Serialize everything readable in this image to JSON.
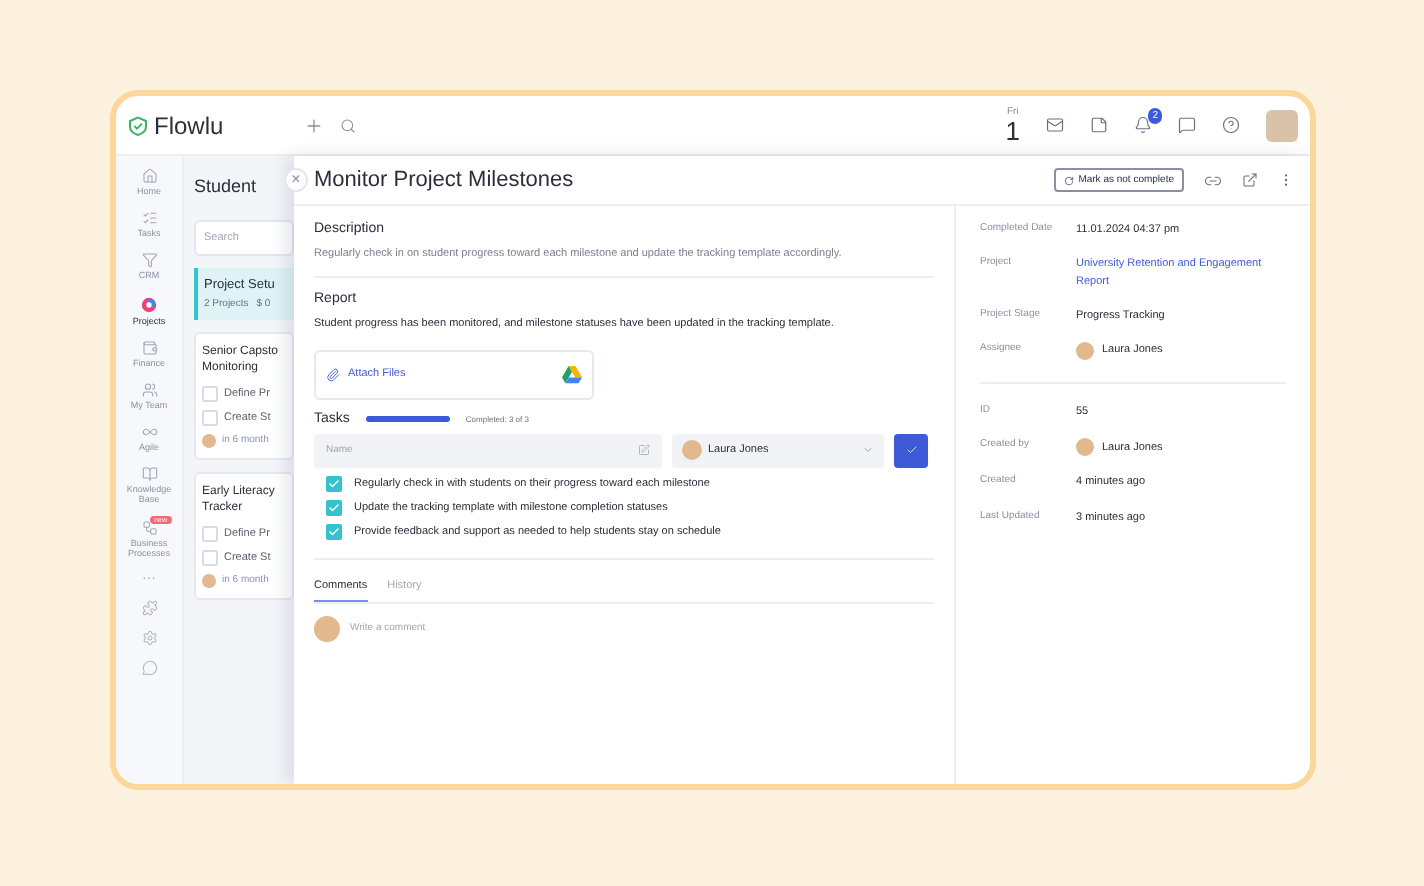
{
  "topbar": {
    "logo": "Flowlu",
    "day": "Fri",
    "date": "1",
    "notification_count": "2"
  },
  "sidebar": {
    "items": [
      {
        "label": "Home",
        "selected": false
      },
      {
        "label": "Tasks",
        "selected": false
      },
      {
        "label": "CRM",
        "selected": false
      },
      {
        "label": "Projects",
        "selected": true
      },
      {
        "label": "Finance",
        "selected": false
      },
      {
        "label": "My Team",
        "selected": false
      },
      {
        "label": "Agile",
        "selected": false
      },
      {
        "label": "Knowledge Base",
        "selected": false
      },
      {
        "label": "Business Processes",
        "selected": false,
        "badge": "new"
      }
    ],
    "more": "···"
  },
  "list_panel": {
    "title": "Student",
    "search_placeholder": "Search",
    "stage": {
      "title": "Project Setu",
      "projects": "2 Projects",
      "amount": "$ 0"
    },
    "cards": [
      {
        "title": "Senior Capsto Monitoring",
        "tasks": [
          {
            "label": "Define Pr",
            "checked": false
          },
          {
            "label": "Create St",
            "checked": false
          }
        ],
        "due": "in 6 month"
      },
      {
        "title": "Early Literacy Tracker",
        "tasks": [
          {
            "label": "Define Pr",
            "checked": false
          },
          {
            "label": "Create St",
            "checked": false
          }
        ],
        "due": "in 6 month"
      }
    ]
  },
  "task": {
    "title": "Monitor Project Milestones",
    "close": "×",
    "mark_button": "Mark as not complete",
    "description": {
      "heading": "Description",
      "text": "Regularly check in on student progress toward each milestone and update the tracking template accordingly."
    },
    "report": {
      "heading": "Report",
      "text": "Student progress has been monitored, and milestone statuses have been updated in the tracking template."
    },
    "attach": "Attach Files",
    "tasks": {
      "heading": "Tasks",
      "level": 1,
      "completed": "Completed: 3 of 3",
      "name_placeholder": "Name",
      "assignee": "Laura Jones",
      "items": [
        {
          "label": "Regularly check in with students on their progress toward each milestone",
          "checked": true
        },
        {
          "label": "Update the tracking template with milestone completion statuses",
          "checked": true
        },
        {
          "label": "Provide feedback and support as needed to help students stay on schedule",
          "checked": true
        }
      ]
    },
    "tabs": [
      {
        "label": "Comments",
        "selected": true
      },
      {
        "label": "History",
        "selected": false
      }
    ],
    "comment_placeholder": "Write a comment",
    "details": [
      {
        "label": "Completed Date",
        "value": "11.01.2024 04:37 pm",
        "kind": "text"
      },
      {
        "label": "Project",
        "value": "University Retention and Engagement Report",
        "kind": "link"
      },
      {
        "label": "Project Stage",
        "value": "Progress Tracking",
        "kind": "text"
      },
      {
        "label": "Assignee",
        "value": "Laura Jones",
        "kind": "person"
      }
    ],
    "meta": [
      {
        "label": "ID",
        "value": "55",
        "kind": "text"
      },
      {
        "label": "Created by",
        "value": "Laura Jones",
        "kind": "person"
      },
      {
        "label": "Created",
        "value": "4 minutes ago",
        "kind": "text"
      },
      {
        "label": "Last Updated",
        "value": "3 minutes ago",
        "kind": "text"
      }
    ]
  }
}
